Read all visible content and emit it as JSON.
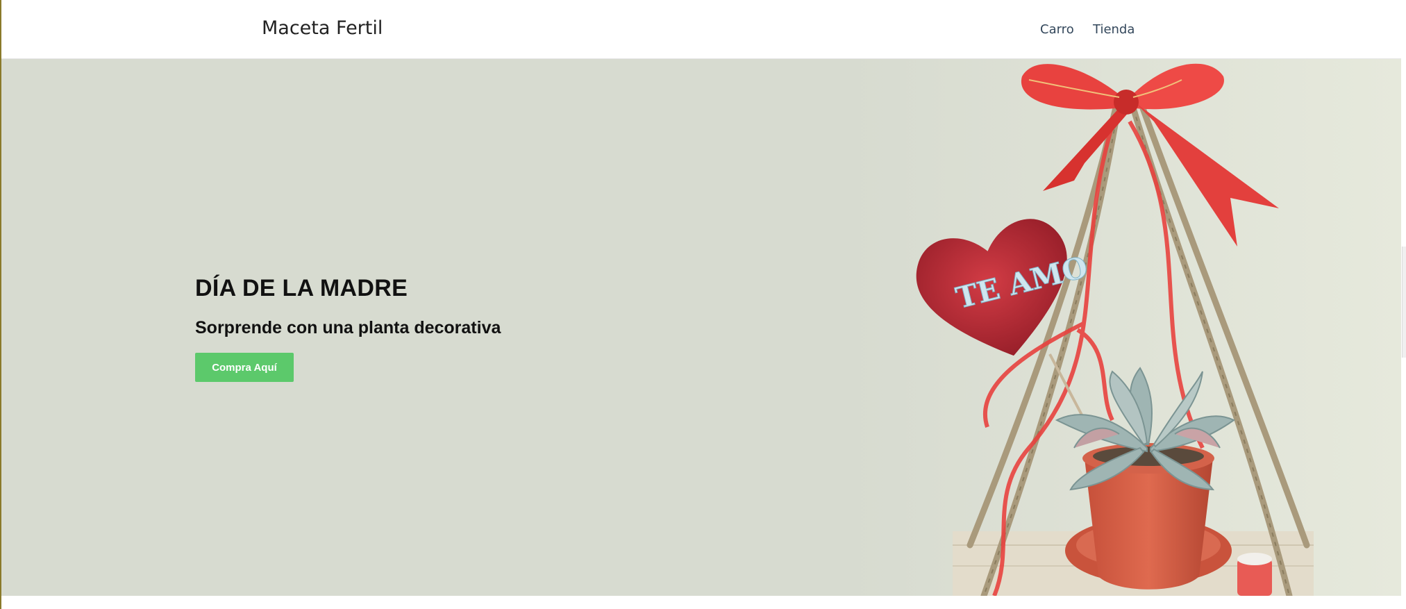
{
  "navbar": {
    "brand": "Maceta Fertil",
    "links": [
      "Carro",
      "Tienda"
    ]
  },
  "hero": {
    "title": "DÍA DE LA MADRE",
    "subtitle": "Sorprende con una planta decorativa",
    "button_label": "Compra Aquí",
    "heart_text": "TE AMO"
  },
  "colors": {
    "accent_button": "#5cc96b",
    "hero_background": "#d7dbd0",
    "ribbon": "#e8423f",
    "heart": "#b8232f"
  },
  "icons": [
    "bow-ribbon-image",
    "heart-ornament-image",
    "succulent-pot-image"
  ]
}
